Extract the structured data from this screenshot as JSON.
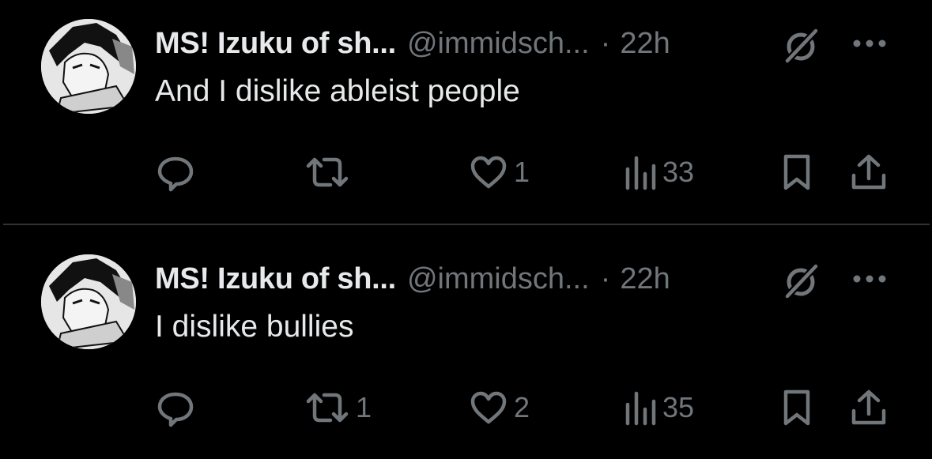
{
  "posts": [
    {
      "author_name": "MS! Izuku of sh...",
      "handle": "@immidsch...",
      "separator": "·",
      "time": "22h",
      "text": "And I dislike ableist people",
      "reply_count": "",
      "repost_count": "",
      "like_count": "1",
      "view_count": "33"
    },
    {
      "author_name": "MS! Izuku of sh...",
      "handle": "@immidsch...",
      "separator": "·",
      "time": "22h",
      "text": "I dislike bullies",
      "reply_count": "",
      "repost_count": "1",
      "like_count": "2",
      "view_count": "35"
    }
  ],
  "icons": {
    "reply": "reply-icon",
    "repost": "repost-icon",
    "like": "heart-icon",
    "views": "views-icon",
    "bookmark": "bookmark-icon",
    "share": "share-icon",
    "grok": "grok-icon",
    "more": "more-icon"
  },
  "colors": {
    "background": "#000000",
    "primary_text": "#e7e9ea",
    "secondary_text": "#71767b",
    "divider": "#2f3336"
  }
}
